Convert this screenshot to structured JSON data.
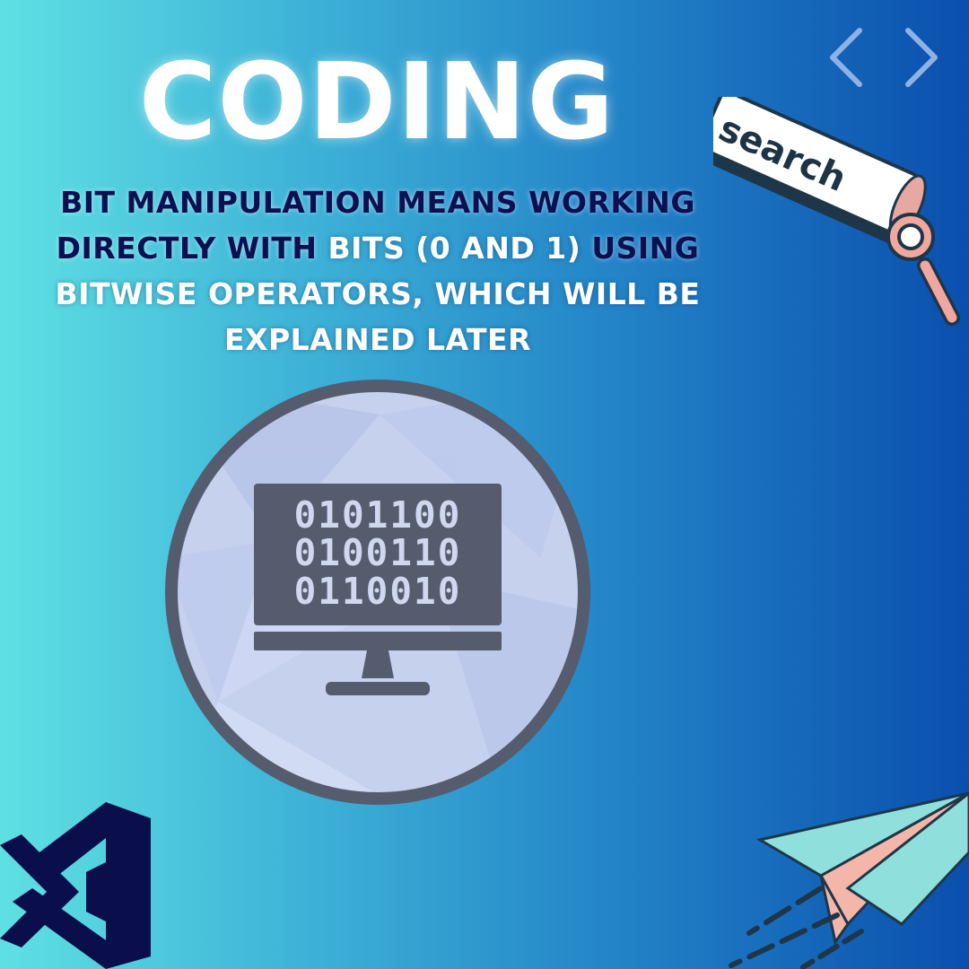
{
  "title": "CODING",
  "paragraph": {
    "line1": "BIT MANIPULATION MEANS WORKING",
    "line2a": "DIRECTLY WITH",
    "line2b": "BITS (0 AND 1)",
    "line2c": "USING",
    "line3": "BITWISE OPERATORS, WHICH WILL BE",
    "line4": "EXPLAINED LATER"
  },
  "monitor": {
    "row1": "0101100",
    "row2": "0100110",
    "row3": "0110010"
  },
  "search_bar": {
    "label": "search"
  },
  "icons": {
    "nav": [
      "chevron-left-icon",
      "chevron-right-icon"
    ],
    "logo": "visual-studio-logo",
    "decor": [
      "search-bar-illustration",
      "magnifier-icon",
      "computer-monitor-icon",
      "paper-plane-illustration"
    ]
  },
  "colors": {
    "title": "#ffffff",
    "dark_text": "#0c0f52",
    "circle_fill": "#c6d1ee",
    "circle_stroke": "#555c6d",
    "monitor": "#555c6d",
    "logo": "#0a0e4a",
    "plane_teal": "#8fe0dc",
    "plane_pink": "#f5b6aa"
  }
}
